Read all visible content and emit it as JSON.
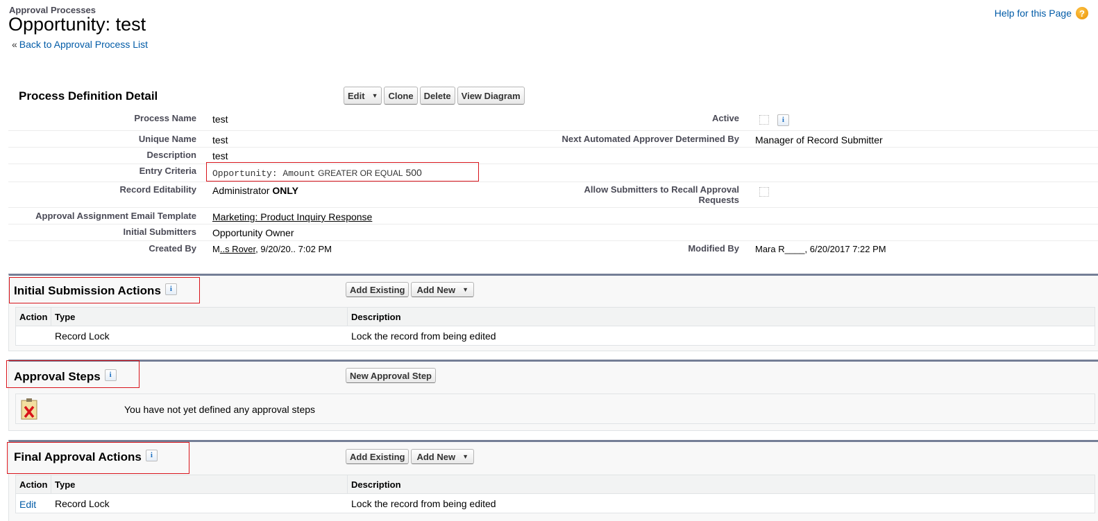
{
  "header": {
    "breadcrumb": "Approval Processes",
    "title": "Opportunity: test",
    "back_link_prefix": "«",
    "back_link": "Back to Approval Process List",
    "help_link": "Help for this Page",
    "help_icon": "question-circle-icon"
  },
  "process_definition": {
    "title": "Process Definition Detail",
    "buttons": {
      "edit": "Edit",
      "clone": "Clone",
      "delete": "Delete",
      "view_diagram": "View Diagram"
    },
    "fields": {
      "process_name": {
        "label": "Process Name",
        "value": "test"
      },
      "active": {
        "label": "Active",
        "checked": false
      },
      "unique_name": {
        "label": "Unique Name",
        "value": "test"
      },
      "next_approver": {
        "label": "Next Automated Approver Determined By",
        "value": "Manager of Record Submitter"
      },
      "description": {
        "label": "Description",
        "value": "test"
      },
      "entry_criteria": {
        "label": "Entry Criteria",
        "field": "Opportunity: Amount",
        "operator": "GREATER OR EQUAL",
        "value": "500"
      },
      "record_editability": {
        "label": "Record Editability",
        "value_prefix": "Administrator",
        "value_bold": "ONLY"
      },
      "allow_recall": {
        "label_line1": "Allow Submitters to Recall Approval",
        "label_line2": "Requests",
        "checked": false
      },
      "email_template": {
        "label": "Approval Assignment Email Template",
        "value": "Marketing: Product Inquiry Response"
      },
      "initial_submitters": {
        "label": "Initial Submitters",
        "value": "Opportunity Owner"
      },
      "created_by": {
        "label": "Created By",
        "value_prefix": "M",
        "value_link": "..s Rover",
        "value_suffix": ", 9/20/20.. 7:02 PM"
      },
      "modified_by": {
        "label": "Modified By",
        "value": "Mara R____, 6/20/2017 7:22 PM"
      }
    }
  },
  "initial_submission": {
    "title": "Initial Submission Actions",
    "buttons": {
      "add_existing": "Add Existing",
      "add_new": "Add New"
    },
    "columns": [
      "Action",
      "Type",
      "Description"
    ],
    "rows": [
      {
        "action": "",
        "type": "Record Lock",
        "description": "Lock the record from being edited"
      }
    ]
  },
  "approval_steps": {
    "title": "Approval Steps",
    "button": "New Approval Step",
    "empty_message": "You have not yet defined any approval steps"
  },
  "final_approval": {
    "title": "Final Approval Actions",
    "buttons": {
      "add_existing": "Add Existing",
      "add_new": "Add New"
    },
    "columns": [
      "Action",
      "Type",
      "Description"
    ],
    "rows": [
      {
        "action": "Edit",
        "type": "Record Lock",
        "description": "Lock the record from being edited"
      }
    ]
  },
  "colors": {
    "link": "#015ba7",
    "highlight": "#d8131a",
    "section_border": "#747e96"
  }
}
